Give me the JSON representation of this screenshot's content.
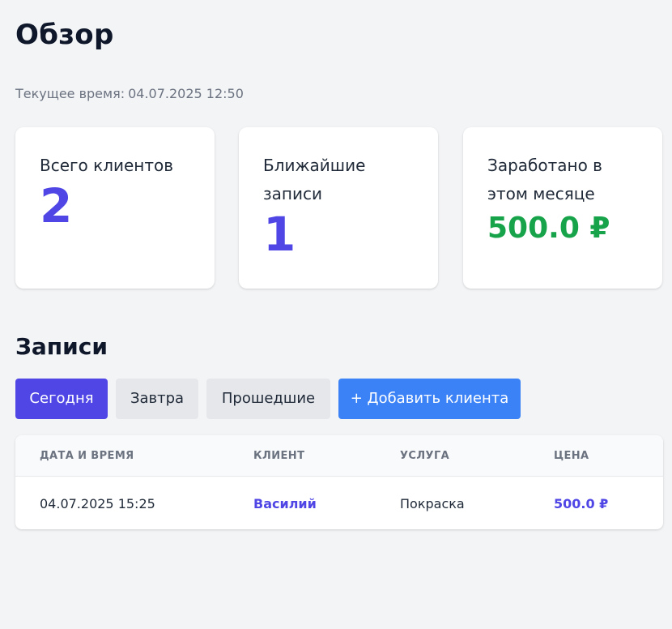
{
  "header": {
    "title": "Обзор",
    "current_time_label": "Текущее время:",
    "current_time_value": "04.07.2025 12:50"
  },
  "stats": [
    {
      "label": "Всего клиентов",
      "value": "2"
    },
    {
      "label": "Ближайшие записи",
      "value": "1"
    },
    {
      "label": "Заработано в этом месяце",
      "value": "500.0 ₽"
    }
  ],
  "colors": {
    "accent": "#4f46e5",
    "money": "#16a34a",
    "add_button": "#3b82f6",
    "background": "#f3f4f6"
  },
  "appointments": {
    "title": "Записи",
    "tabs": [
      {
        "label": "Сегодня",
        "active": true
      },
      {
        "label": "Завтра",
        "active": false
      },
      {
        "label": "Прошедшие",
        "active": false
      }
    ],
    "add_button_label": "+ Добавить клиента",
    "columns": [
      "Дата и время",
      "Клиент",
      "Услуга",
      "Цена"
    ],
    "rows": [
      {
        "datetime": "04.07.2025 15:25",
        "client": "Василий",
        "service": "Покраска",
        "price": "500.0 ₽"
      }
    ]
  }
}
